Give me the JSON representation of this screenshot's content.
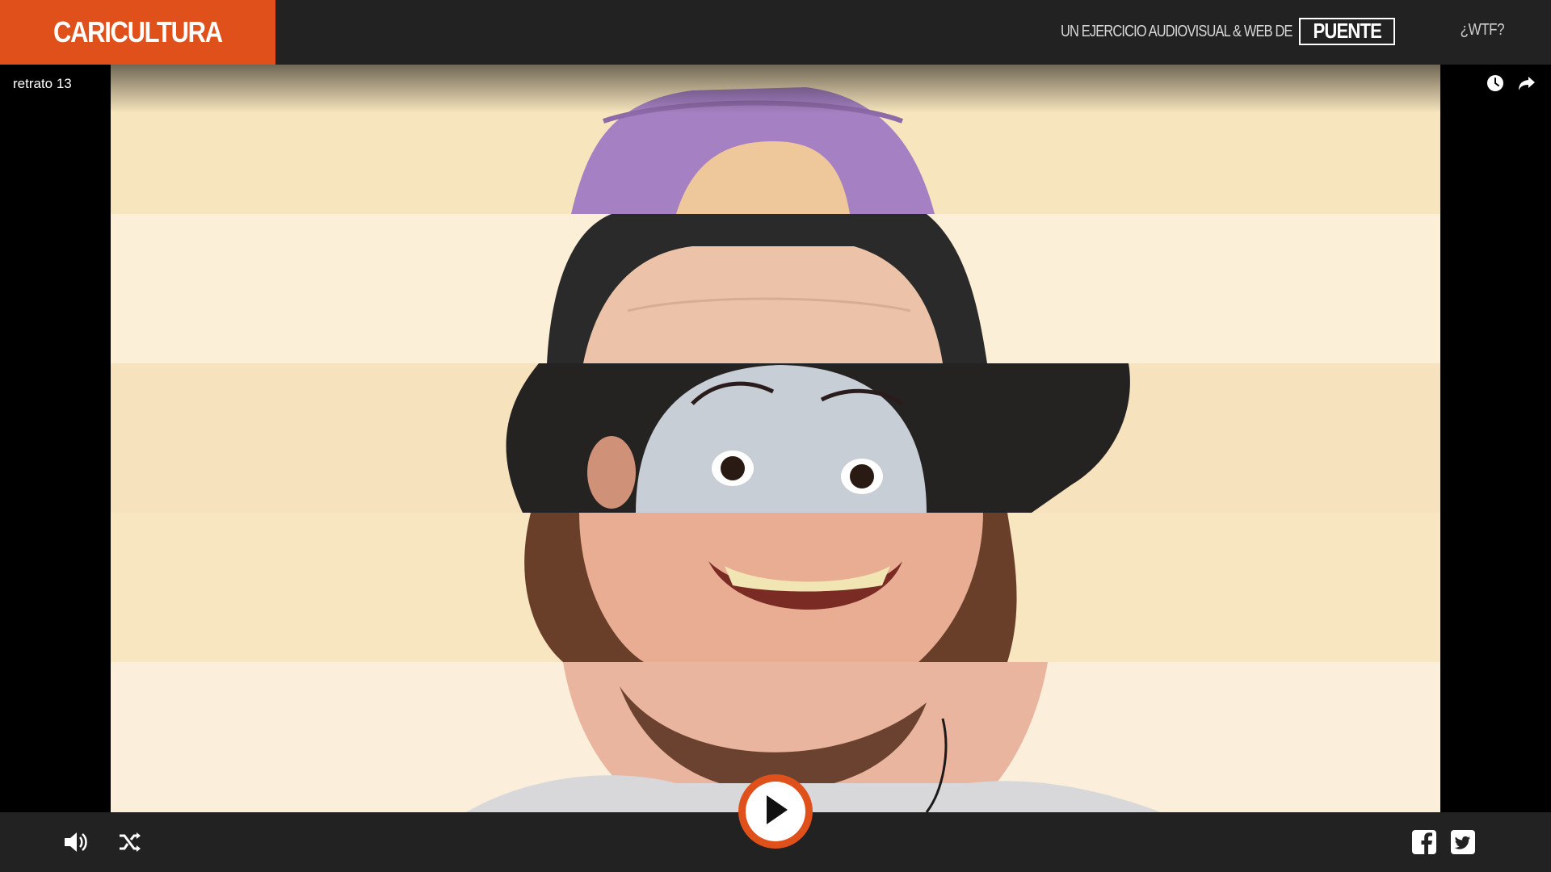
{
  "header": {
    "brand": "CARICULTURA",
    "credit_text": "UN EJERCICIO AUDIOVISUAL & WEB DE",
    "credit_logo": "PUENTE",
    "wtf_link": "¿WTF?"
  },
  "player": {
    "portrait_title": "retrato 13",
    "icons": {
      "history": "clock-icon",
      "share": "share-arrow-icon",
      "volume": "volume-icon",
      "shuffle": "shuffle-icon",
      "play": "play-icon",
      "facebook": "facebook-icon",
      "twitter": "twitter-icon"
    }
  },
  "colors": {
    "accent": "#e0501b",
    "bar": "#222222",
    "background": "#000000"
  }
}
